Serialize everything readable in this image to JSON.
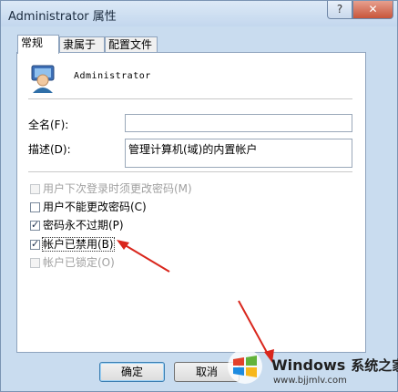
{
  "window": {
    "title": "Administrator 属性",
    "help_label": "?",
    "close_label": "✕"
  },
  "tabs": [
    {
      "label": "常规",
      "active": true
    },
    {
      "label": "隶属于",
      "active": false
    },
    {
      "label": "配置文件",
      "active": false
    }
  ],
  "general": {
    "username": "Administrator",
    "fullname_label": "全名(F):",
    "fullname_value": "",
    "description_label": "描述(D):",
    "description_value": "管理计算机(域)的内置帐户"
  },
  "checkboxes": [
    {
      "label": "用户下次登录时须更改密码(M)",
      "checked": false,
      "enabled": false
    },
    {
      "label": "用户不能更改密码(C)",
      "checked": false,
      "enabled": true
    },
    {
      "label": "密码永不过期(P)",
      "checked": true,
      "enabled": true
    },
    {
      "label": "帐户已禁用(B)",
      "checked": true,
      "enabled": true
    },
    {
      "label": "帐户已锁定(O)",
      "checked": false,
      "enabled": false
    }
  ],
  "buttons": {
    "ok": "确定",
    "cancel": "取消"
  },
  "watermark": {
    "brand": "Windows",
    "brand_cn": "系统之家",
    "url": "www.bjjmlv.com"
  },
  "colors": {
    "arrow": "#d9261c",
    "accent": "#3c7fb1"
  }
}
